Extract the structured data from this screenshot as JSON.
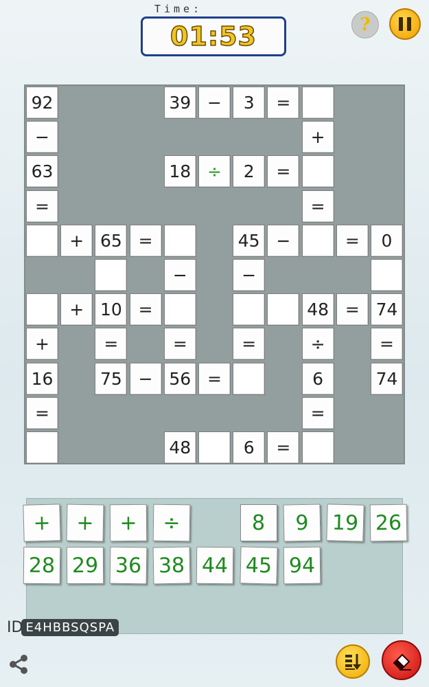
{
  "header": {
    "time_label": "Time:",
    "timer": "01:53"
  },
  "icons": {
    "help": "question-mark-icon",
    "pause": "pause-icon",
    "share": "share-icon",
    "sort": "sort-tiles-icon",
    "erase": "eraser-icon"
  },
  "help_glyph": "?",
  "colors": {
    "board_background": "#939e9f",
    "operator_green": "#2f9a2f",
    "tile_text_green": "#1e8a1e",
    "timer_yellow": "#f2c425",
    "timer_border": "#1f3f8a",
    "tray_background": "#b9cfcd"
  },
  "grid": {
    "rows": 11,
    "cols": 11,
    "cells": [
      {
        "r": 0,
        "c": 0,
        "v": "92"
      },
      {
        "r": 0,
        "c": 4,
        "v": "39"
      },
      {
        "r": 0,
        "c": 5,
        "v": "−"
      },
      {
        "r": 0,
        "c": 6,
        "v": "3"
      },
      {
        "r": 0,
        "c": 7,
        "v": "="
      },
      {
        "r": 0,
        "c": 8,
        "v": ""
      },
      {
        "r": 1,
        "c": 0,
        "v": "−"
      },
      {
        "r": 1,
        "c": 8,
        "v": "+"
      },
      {
        "r": 2,
        "c": 0,
        "v": "63"
      },
      {
        "r": 2,
        "c": 4,
        "v": "18"
      },
      {
        "r": 2,
        "c": 5,
        "v": "÷",
        "green": true
      },
      {
        "r": 2,
        "c": 6,
        "v": "2"
      },
      {
        "r": 2,
        "c": 7,
        "v": "="
      },
      {
        "r": 2,
        "c": 8,
        "v": ""
      },
      {
        "r": 3,
        "c": 0,
        "v": "="
      },
      {
        "r": 3,
        "c": 8,
        "v": "="
      },
      {
        "r": 4,
        "c": 0,
        "v": ""
      },
      {
        "r": 4,
        "c": 1,
        "v": "+"
      },
      {
        "r": 4,
        "c": 2,
        "v": "65"
      },
      {
        "r": 4,
        "c": 3,
        "v": "="
      },
      {
        "r": 4,
        "c": 4,
        "v": ""
      },
      {
        "r": 4,
        "c": 6,
        "v": "45"
      },
      {
        "r": 4,
        "c": 7,
        "v": "−"
      },
      {
        "r": 4,
        "c": 8,
        "v": ""
      },
      {
        "r": 4,
        "c": 9,
        "v": "="
      },
      {
        "r": 4,
        "c": 10,
        "v": "0"
      },
      {
        "r": 5,
        "c": 2,
        "v": ""
      },
      {
        "r": 5,
        "c": 4,
        "v": "−"
      },
      {
        "r": 5,
        "c": 6,
        "v": "−"
      },
      {
        "r": 5,
        "c": 10,
        "v": ""
      },
      {
        "r": 6,
        "c": 0,
        "v": ""
      },
      {
        "r": 6,
        "c": 1,
        "v": "+"
      },
      {
        "r": 6,
        "c": 2,
        "v": "10"
      },
      {
        "r": 6,
        "c": 3,
        "v": "="
      },
      {
        "r": 6,
        "c": 4,
        "v": ""
      },
      {
        "r": 6,
        "c": 6,
        "v": ""
      },
      {
        "r": 6,
        "c": 7,
        "v": ""
      },
      {
        "r": 6,
        "c": 8,
        "v": "48"
      },
      {
        "r": 6,
        "c": 9,
        "v": "="
      },
      {
        "r": 6,
        "c": 10,
        "v": "74"
      },
      {
        "r": 7,
        "c": 0,
        "v": "+"
      },
      {
        "r": 7,
        "c": 2,
        "v": "="
      },
      {
        "r": 7,
        "c": 4,
        "v": "="
      },
      {
        "r": 7,
        "c": 6,
        "v": "="
      },
      {
        "r": 7,
        "c": 8,
        "v": "÷"
      },
      {
        "r": 7,
        "c": 10,
        "v": "="
      },
      {
        "r": 8,
        "c": 0,
        "v": "16"
      },
      {
        "r": 8,
        "c": 2,
        "v": "75"
      },
      {
        "r": 8,
        "c": 3,
        "v": "−"
      },
      {
        "r": 8,
        "c": 4,
        "v": "56"
      },
      {
        "r": 8,
        "c": 5,
        "v": "="
      },
      {
        "r": 8,
        "c": 6,
        "v": ""
      },
      {
        "r": 8,
        "c": 8,
        "v": "6"
      },
      {
        "r": 8,
        "c": 10,
        "v": "74"
      },
      {
        "r": 9,
        "c": 0,
        "v": "="
      },
      {
        "r": 9,
        "c": 8,
        "v": "="
      },
      {
        "r": 10,
        "c": 0,
        "v": ""
      },
      {
        "r": 10,
        "c": 4,
        "v": "48"
      },
      {
        "r": 10,
        "c": 5,
        "v": ""
      },
      {
        "r": 10,
        "c": 6,
        "v": "6"
      },
      {
        "r": 10,
        "c": 7,
        "v": "="
      },
      {
        "r": 10,
        "c": 8,
        "v": ""
      }
    ]
  },
  "tray": {
    "tiles": [
      {
        "v": "+",
        "row": 0,
        "slot": 0
      },
      {
        "v": "+",
        "row": 0,
        "slot": 1
      },
      {
        "v": "+",
        "row": 0,
        "slot": 2
      },
      {
        "v": "÷",
        "row": 0,
        "slot": 3
      },
      {
        "v": "8",
        "row": 0,
        "slot": 5
      },
      {
        "v": "9",
        "row": 0,
        "slot": 6
      },
      {
        "v": "19",
        "row": 0,
        "slot": 7
      },
      {
        "v": "26",
        "row": 0,
        "slot": 8
      },
      {
        "v": "28",
        "row": 1,
        "slot": 0
      },
      {
        "v": "29",
        "row": 1,
        "slot": 1
      },
      {
        "v": "36",
        "row": 1,
        "slot": 2
      },
      {
        "v": "38",
        "row": 1,
        "slot": 3
      },
      {
        "v": "44",
        "row": 1,
        "slot": 4
      },
      {
        "v": "45",
        "row": 1,
        "slot": 5
      },
      {
        "v": "94",
        "row": 1,
        "slot": 6
      }
    ]
  },
  "footer": {
    "id_prefix": "ID",
    "puzzle_id": "E4HBBSQSPA"
  }
}
